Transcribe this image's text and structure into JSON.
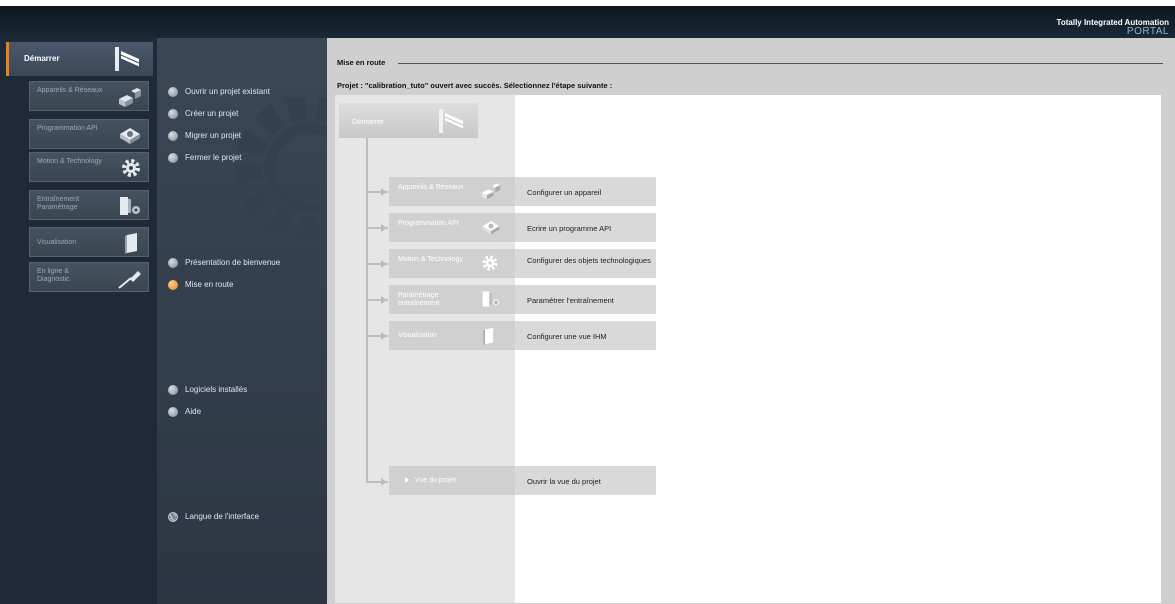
{
  "header": {
    "brand_line1": "Totally Integrated Automation",
    "brand_line2": "PORTAL"
  },
  "nav": {
    "start_label": "Démarrer",
    "items": [
      {
        "label": "Appareils & Réseaux",
        "icon": "network-devices-icon"
      },
      {
        "label": "Programmation API",
        "icon": "plc-programming-icon"
      },
      {
        "label": "Motion & Technology",
        "icon": "gear-icon"
      },
      {
        "label": "Entraînement Paramétrage",
        "icon": "drive-icon"
      },
      {
        "label": "Visualisation",
        "icon": "hmi-panel-icon"
      },
      {
        "label": "En ligne & Diagnostic",
        "icon": "diagnostic-probe-icon"
      }
    ]
  },
  "menu": {
    "open_project": "Ouvrir un projet existant",
    "create_project": "Créer un projet",
    "migrate_project": "Migrer un projet",
    "close_project": "Fermer le projet",
    "welcome_tour": "Présentation de bienvenue",
    "first_steps": "Mise en route",
    "installed_software": "Logiciels installés",
    "help": "Aide",
    "ui_language": "Langue de l'interface",
    "active_item": "Mise en route"
  },
  "main": {
    "title": "Mise en route",
    "status": "Projet : \"calibration_tuto\" ouvert avec succès. Sélectionnez l'étape suivante :",
    "start_box_label": "Démarrer",
    "steps": [
      {
        "label": "Appareils & Réseaux",
        "desc": "Configurer un appareil"
      },
      {
        "label": "Programmation API",
        "desc": "Ecrire un programme API"
      },
      {
        "label": "Motion & Technology",
        "desc": "Configurer des objets technologiques"
      },
      {
        "label": "Paramétrage entraînement",
        "desc": "Paramétrer l'entraînement"
      },
      {
        "label": "Visualisation",
        "desc": "Configurer une vue IHM"
      }
    ],
    "project_view": {
      "label": "Vue du projet",
      "desc": "Ouvrir la vue du projet"
    }
  },
  "colors": {
    "accent": "#e8821e",
    "nav_bg": "#1f2937",
    "brand_blue": "#8fb3d4"
  }
}
